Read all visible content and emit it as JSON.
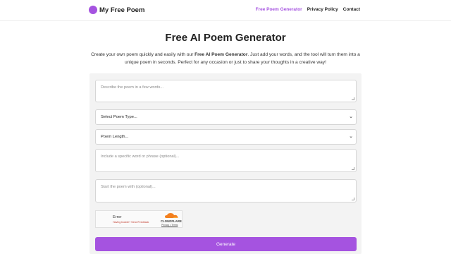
{
  "brand": {
    "name": "My Free Poem",
    "accent": "#a553e0"
  },
  "nav": [
    {
      "label": "Free Poem Generator",
      "active": true
    },
    {
      "label": "Privacy Policy",
      "active": false
    },
    {
      "label": "Contact",
      "active": false
    }
  ],
  "main": {
    "title": "Free AI Poem Generator",
    "intro_before": "Create your own poem quickly and easily with our ",
    "intro_bold": "Free AI Poem Generator",
    "intro_after": ". Just add your words, and the tool will turn them into a unique poem in seconds. Perfect for any occasion or just to share your thoughts in a creative way!"
  },
  "form": {
    "description_placeholder": "Describe the poem in a few words...",
    "poem_type_value": "Select Poem Type...",
    "poem_length_value": "Poem Length...",
    "word_placeholder": "Include a specific word or phrase (optional)...",
    "start_placeholder": "Start the poem with (optional)...",
    "generate_label": "Generate"
  },
  "captcha": {
    "error_title": "Error",
    "error_detail": "Having trouble? Send Feedback",
    "brand": "CLOUDFLARE",
    "links": "Privacy • Terms"
  }
}
